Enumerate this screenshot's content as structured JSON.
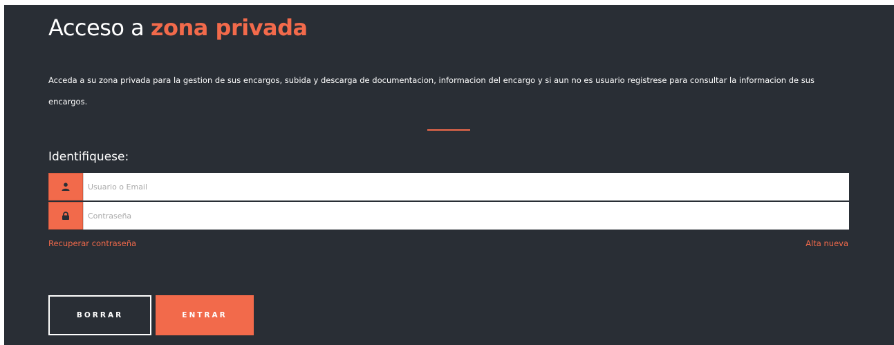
{
  "header": {
    "title_prefix": "Acceso a",
    "title_accent": "zona privada"
  },
  "intro": {
    "text": "Acceda a su zona privada para la gestion de sus encargos, subida y descarga de documentacion, informacion del encargo y si aun no es usuario registrese para consultar la informacion de sus encargos."
  },
  "form": {
    "label": "Identifiquese:",
    "username": {
      "placeholder": "Usuario o Email",
      "value": "",
      "icon": "user-icon"
    },
    "password": {
      "placeholder": "Contraseña",
      "value": "",
      "icon": "lock-icon"
    },
    "recover_link": "Recuperar contraseña",
    "signup_link": "Alta nueva",
    "clear_button": "BORRAR",
    "submit_button": "ENTRAR"
  },
  "colors": {
    "background": "#292e35",
    "accent": "#f26a4b",
    "text": "#ffffff"
  }
}
